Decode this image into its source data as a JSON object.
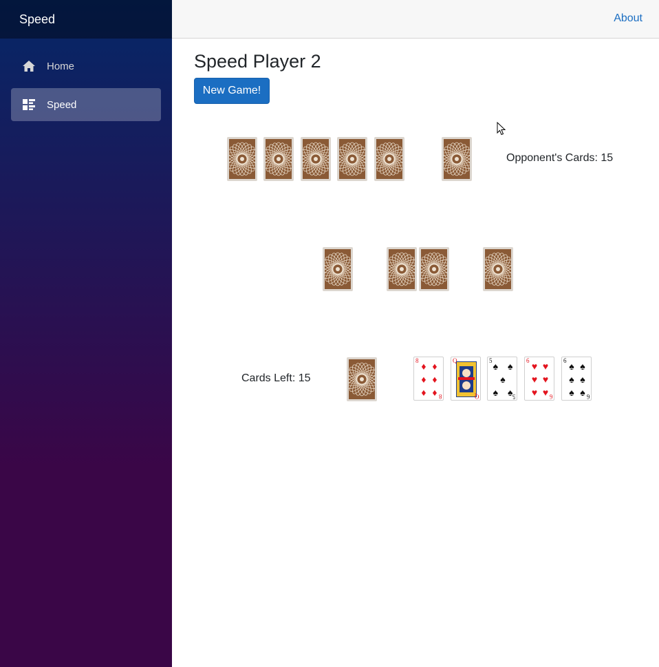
{
  "sidebar": {
    "brand": "Speed",
    "items": [
      {
        "label": "Home",
        "icon": "home-icon",
        "active": false
      },
      {
        "label": "Speed",
        "icon": "list-icon",
        "active": true
      }
    ]
  },
  "top_row": {
    "about": "About"
  },
  "main": {
    "title": "Speed Player 2",
    "new_game_label": "New Game!",
    "opponent_cards_label": "Opponent's Cards: 15",
    "cards_left_label": "Cards Left: 15",
    "player_hand": [
      {
        "rank": "8",
        "suit": "♦",
        "color": "red"
      },
      {
        "rank": "Q",
        "suit": "♥",
        "color": "red",
        "face": true
      },
      {
        "rank": "5",
        "suit": "♠",
        "color": "black"
      },
      {
        "rank": "6",
        "suit": "♥",
        "color": "red"
      },
      {
        "rank": "6",
        "suit": "♠",
        "color": "black"
      }
    ]
  },
  "colors": {
    "accent": "#1b6ec2",
    "sidebar_top": "#052767",
    "sidebar_bottom": "#3a0647",
    "card_back": "#8a5a36",
    "red_suit": "#e3141e"
  }
}
